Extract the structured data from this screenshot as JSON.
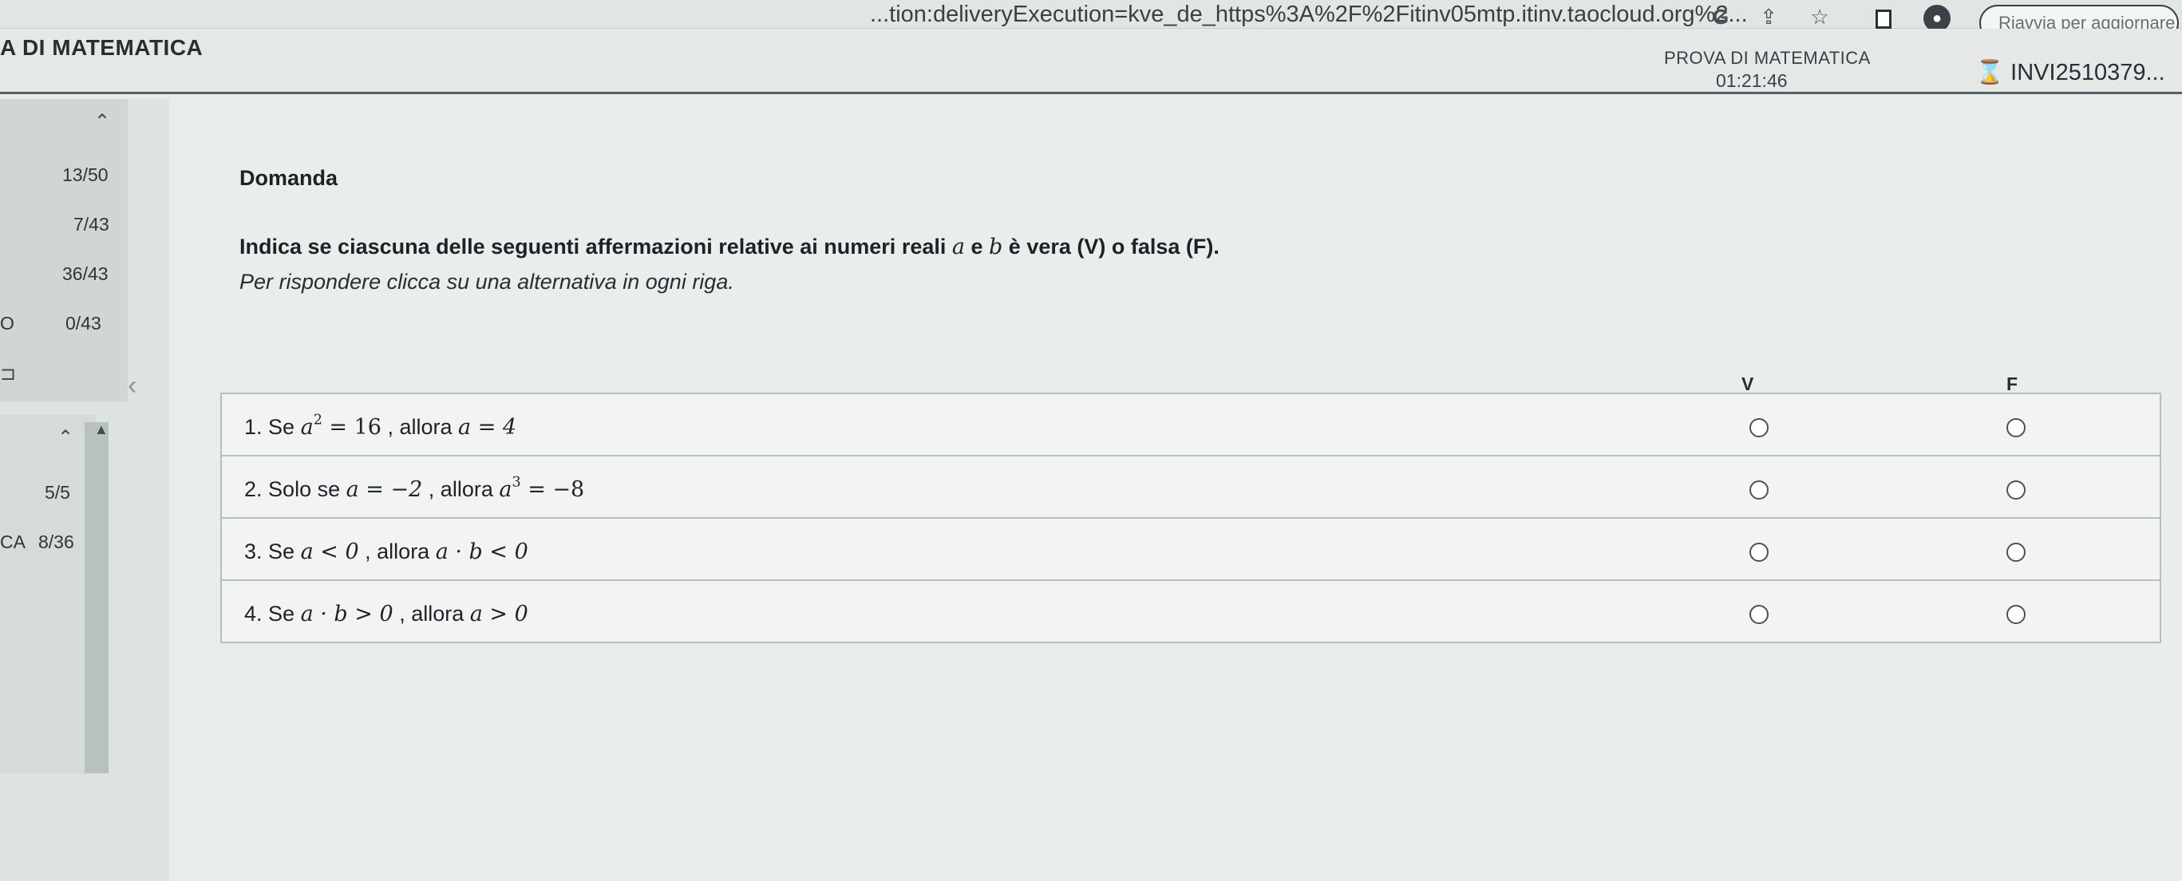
{
  "browser": {
    "url": "...tion:deliveryExecution=kve_de_https%3A%2F%2Fitinv05mtp.itinv.taocloud.org%2...",
    "reload_label": "Riavvia per aggiornare"
  },
  "header": {
    "test_title": "A DI MATEMATICA",
    "test_label": "PROVA DI MATEMATICA",
    "timer": "01:21:46",
    "user_id": "INVI2510379..."
  },
  "sidebar": {
    "counts": [
      "13/50",
      "7/43",
      "36/43",
      "0/43"
    ],
    "prefix_o": "O",
    "lower_count": "5/5",
    "lower_prefix": "CA",
    "lower_item_count": "8/36"
  },
  "question": {
    "section_title": "Domanda",
    "instruction_before": "Indica se ciascuna delle seguenti affermazioni relative ai numeri reali ",
    "var_a": "a",
    "and_word": " e ",
    "var_b": "b",
    "instruction_after": " è vera (V) o falsa (F).",
    "hint": "Per rispondere clicca su una alternativa in ogni riga.",
    "col_true": "V",
    "col_false": "F",
    "rows": [
      {
        "num": "1.",
        "pre": "Se ",
        "lhs": "a",
        "sup": "2",
        "op": " = 16",
        "mid": " , allora ",
        "rhs": "a = 4"
      },
      {
        "num": "2.",
        "pre": "Solo se ",
        "lhs": "a = −2",
        "mid": " , allora ",
        "rhs_base": "a",
        "rhs_sup": "3",
        "rhs_rest": " = −8"
      },
      {
        "num": "3.",
        "pre": "Se ",
        "lhs": "a < 0",
        "mid": " , allora ",
        "rhs": "a · b < 0"
      },
      {
        "num": "4.",
        "pre": "Se ",
        "lhs": "a · b > 0",
        "mid": " , allora ",
        "rhs": "a > 0"
      }
    ]
  }
}
